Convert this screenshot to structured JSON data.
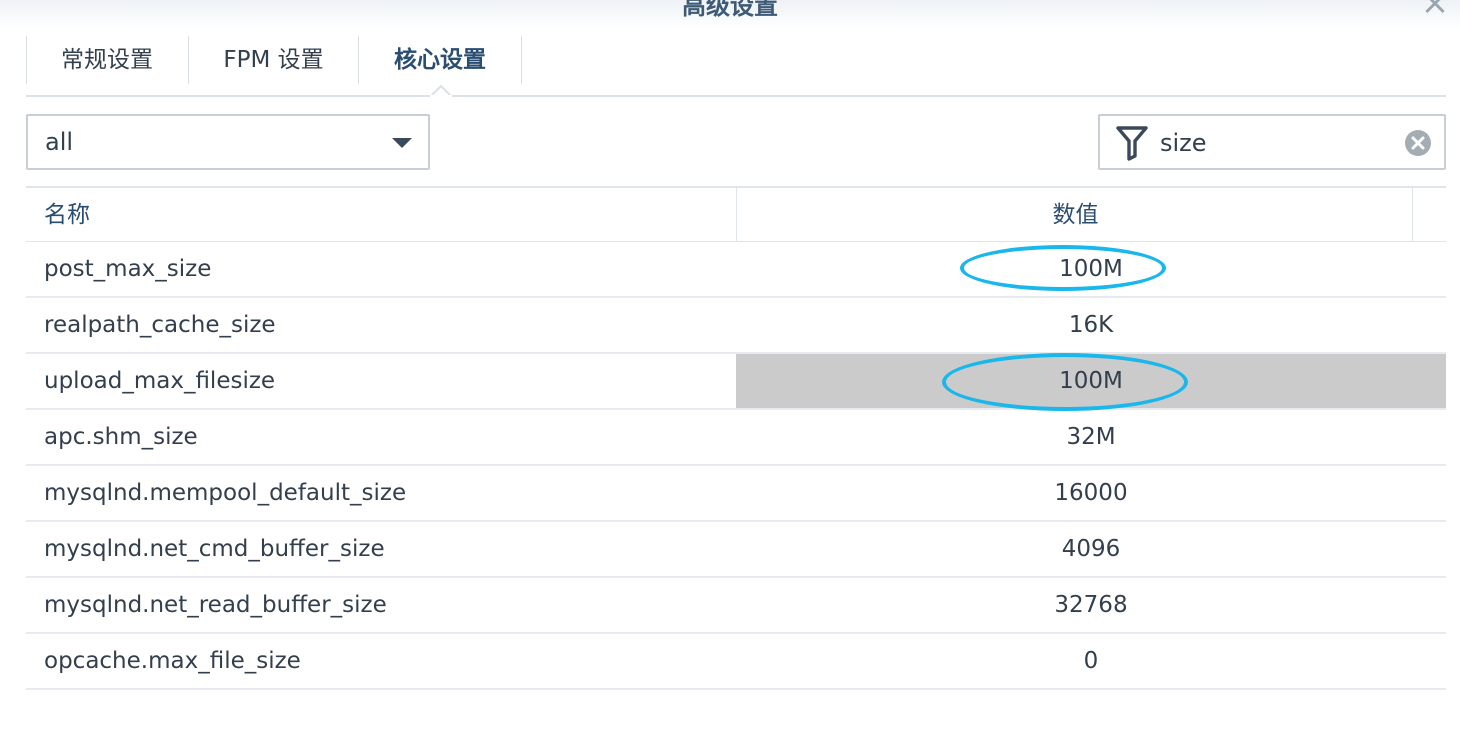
{
  "window": {
    "title": "高级设置",
    "close_icon": "close-icon"
  },
  "tabs": [
    {
      "label": "常规设置",
      "active": false
    },
    {
      "label": "FPM 设置",
      "active": false
    },
    {
      "label": "核心设置",
      "active": true
    }
  ],
  "toolbar": {
    "category_select": {
      "value": "all"
    },
    "filter": {
      "value": "size",
      "icon": "filter-icon",
      "clear_icon": "clear-icon"
    }
  },
  "grid": {
    "columns": {
      "name": "名称",
      "value": "数值"
    },
    "rows": [
      {
        "name": "post_max_size",
        "value": "100M"
      },
      {
        "name": "realpath_cache_size",
        "value": "16K"
      },
      {
        "name": "upload_max_filesize",
        "value": "100M"
      },
      {
        "name": "apc.shm_size",
        "value": "32M"
      },
      {
        "name": "mysqlnd.mempool_default_size",
        "value": "16000"
      },
      {
        "name": "mysqlnd.net_cmd_buffer_size",
        "value": "4096"
      },
      {
        "name": "mysqlnd.net_read_buffer_size",
        "value": "32768"
      },
      {
        "name": "opcache.max_file_size",
        "value": "0"
      }
    ]
  },
  "colors": {
    "accent_text": "#2a4d72",
    "selected_row": "#cbcbcb",
    "annotation": "#1ab7ea"
  }
}
